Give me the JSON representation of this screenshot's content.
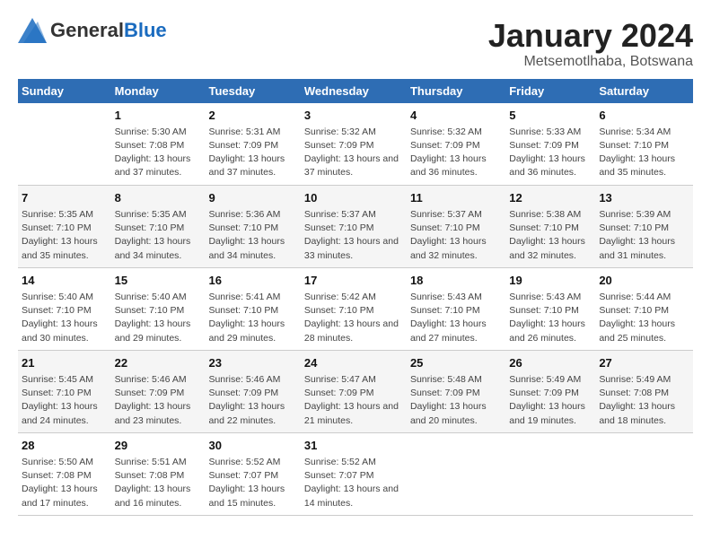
{
  "header": {
    "logo": {
      "general": "General",
      "blue": "Blue"
    },
    "title": "January 2024",
    "location": "Metsemotlhaba, Botswana"
  },
  "columns": [
    "Sunday",
    "Monday",
    "Tuesday",
    "Wednesday",
    "Thursday",
    "Friday",
    "Saturday"
  ],
  "weeks": [
    [
      {
        "day": "",
        "sunrise": "",
        "sunset": "",
        "daylight": ""
      },
      {
        "day": "1",
        "sunrise": "Sunrise: 5:30 AM",
        "sunset": "Sunset: 7:08 PM",
        "daylight": "Daylight: 13 hours and 37 minutes."
      },
      {
        "day": "2",
        "sunrise": "Sunrise: 5:31 AM",
        "sunset": "Sunset: 7:09 PM",
        "daylight": "Daylight: 13 hours and 37 minutes."
      },
      {
        "day": "3",
        "sunrise": "Sunrise: 5:32 AM",
        "sunset": "Sunset: 7:09 PM",
        "daylight": "Daylight: 13 hours and 37 minutes."
      },
      {
        "day": "4",
        "sunrise": "Sunrise: 5:32 AM",
        "sunset": "Sunset: 7:09 PM",
        "daylight": "Daylight: 13 hours and 36 minutes."
      },
      {
        "day": "5",
        "sunrise": "Sunrise: 5:33 AM",
        "sunset": "Sunset: 7:09 PM",
        "daylight": "Daylight: 13 hours and 36 minutes."
      },
      {
        "day": "6",
        "sunrise": "Sunrise: 5:34 AM",
        "sunset": "Sunset: 7:10 PM",
        "daylight": "Daylight: 13 hours and 35 minutes."
      }
    ],
    [
      {
        "day": "7",
        "sunrise": "Sunrise: 5:35 AM",
        "sunset": "Sunset: 7:10 PM",
        "daylight": "Daylight: 13 hours and 35 minutes."
      },
      {
        "day": "8",
        "sunrise": "Sunrise: 5:35 AM",
        "sunset": "Sunset: 7:10 PM",
        "daylight": "Daylight: 13 hours and 34 minutes."
      },
      {
        "day": "9",
        "sunrise": "Sunrise: 5:36 AM",
        "sunset": "Sunset: 7:10 PM",
        "daylight": "Daylight: 13 hours and 34 minutes."
      },
      {
        "day": "10",
        "sunrise": "Sunrise: 5:37 AM",
        "sunset": "Sunset: 7:10 PM",
        "daylight": "Daylight: 13 hours and 33 minutes."
      },
      {
        "day": "11",
        "sunrise": "Sunrise: 5:37 AM",
        "sunset": "Sunset: 7:10 PM",
        "daylight": "Daylight: 13 hours and 32 minutes."
      },
      {
        "day": "12",
        "sunrise": "Sunrise: 5:38 AM",
        "sunset": "Sunset: 7:10 PM",
        "daylight": "Daylight: 13 hours and 32 minutes."
      },
      {
        "day": "13",
        "sunrise": "Sunrise: 5:39 AM",
        "sunset": "Sunset: 7:10 PM",
        "daylight": "Daylight: 13 hours and 31 minutes."
      }
    ],
    [
      {
        "day": "14",
        "sunrise": "Sunrise: 5:40 AM",
        "sunset": "Sunset: 7:10 PM",
        "daylight": "Daylight: 13 hours and 30 minutes."
      },
      {
        "day": "15",
        "sunrise": "Sunrise: 5:40 AM",
        "sunset": "Sunset: 7:10 PM",
        "daylight": "Daylight: 13 hours and 29 minutes."
      },
      {
        "day": "16",
        "sunrise": "Sunrise: 5:41 AM",
        "sunset": "Sunset: 7:10 PM",
        "daylight": "Daylight: 13 hours and 29 minutes."
      },
      {
        "day": "17",
        "sunrise": "Sunrise: 5:42 AM",
        "sunset": "Sunset: 7:10 PM",
        "daylight": "Daylight: 13 hours and 28 minutes."
      },
      {
        "day": "18",
        "sunrise": "Sunrise: 5:43 AM",
        "sunset": "Sunset: 7:10 PM",
        "daylight": "Daylight: 13 hours and 27 minutes."
      },
      {
        "day": "19",
        "sunrise": "Sunrise: 5:43 AM",
        "sunset": "Sunset: 7:10 PM",
        "daylight": "Daylight: 13 hours and 26 minutes."
      },
      {
        "day": "20",
        "sunrise": "Sunrise: 5:44 AM",
        "sunset": "Sunset: 7:10 PM",
        "daylight": "Daylight: 13 hours and 25 minutes."
      }
    ],
    [
      {
        "day": "21",
        "sunrise": "Sunrise: 5:45 AM",
        "sunset": "Sunset: 7:10 PM",
        "daylight": "Daylight: 13 hours and 24 minutes."
      },
      {
        "day": "22",
        "sunrise": "Sunrise: 5:46 AM",
        "sunset": "Sunset: 7:09 PM",
        "daylight": "Daylight: 13 hours and 23 minutes."
      },
      {
        "day": "23",
        "sunrise": "Sunrise: 5:46 AM",
        "sunset": "Sunset: 7:09 PM",
        "daylight": "Daylight: 13 hours and 22 minutes."
      },
      {
        "day": "24",
        "sunrise": "Sunrise: 5:47 AM",
        "sunset": "Sunset: 7:09 PM",
        "daylight": "Daylight: 13 hours and 21 minutes."
      },
      {
        "day": "25",
        "sunrise": "Sunrise: 5:48 AM",
        "sunset": "Sunset: 7:09 PM",
        "daylight": "Daylight: 13 hours and 20 minutes."
      },
      {
        "day": "26",
        "sunrise": "Sunrise: 5:49 AM",
        "sunset": "Sunset: 7:09 PM",
        "daylight": "Daylight: 13 hours and 19 minutes."
      },
      {
        "day": "27",
        "sunrise": "Sunrise: 5:49 AM",
        "sunset": "Sunset: 7:08 PM",
        "daylight": "Daylight: 13 hours and 18 minutes."
      }
    ],
    [
      {
        "day": "28",
        "sunrise": "Sunrise: 5:50 AM",
        "sunset": "Sunset: 7:08 PM",
        "daylight": "Daylight: 13 hours and 17 minutes."
      },
      {
        "day": "29",
        "sunrise": "Sunrise: 5:51 AM",
        "sunset": "Sunset: 7:08 PM",
        "daylight": "Daylight: 13 hours and 16 minutes."
      },
      {
        "day": "30",
        "sunrise": "Sunrise: 5:52 AM",
        "sunset": "Sunset: 7:07 PM",
        "daylight": "Daylight: 13 hours and 15 minutes."
      },
      {
        "day": "31",
        "sunrise": "Sunrise: 5:52 AM",
        "sunset": "Sunset: 7:07 PM",
        "daylight": "Daylight: 13 hours and 14 minutes."
      },
      {
        "day": "",
        "sunrise": "",
        "sunset": "",
        "daylight": ""
      },
      {
        "day": "",
        "sunrise": "",
        "sunset": "",
        "daylight": ""
      },
      {
        "day": "",
        "sunrise": "",
        "sunset": "",
        "daylight": ""
      }
    ]
  ]
}
